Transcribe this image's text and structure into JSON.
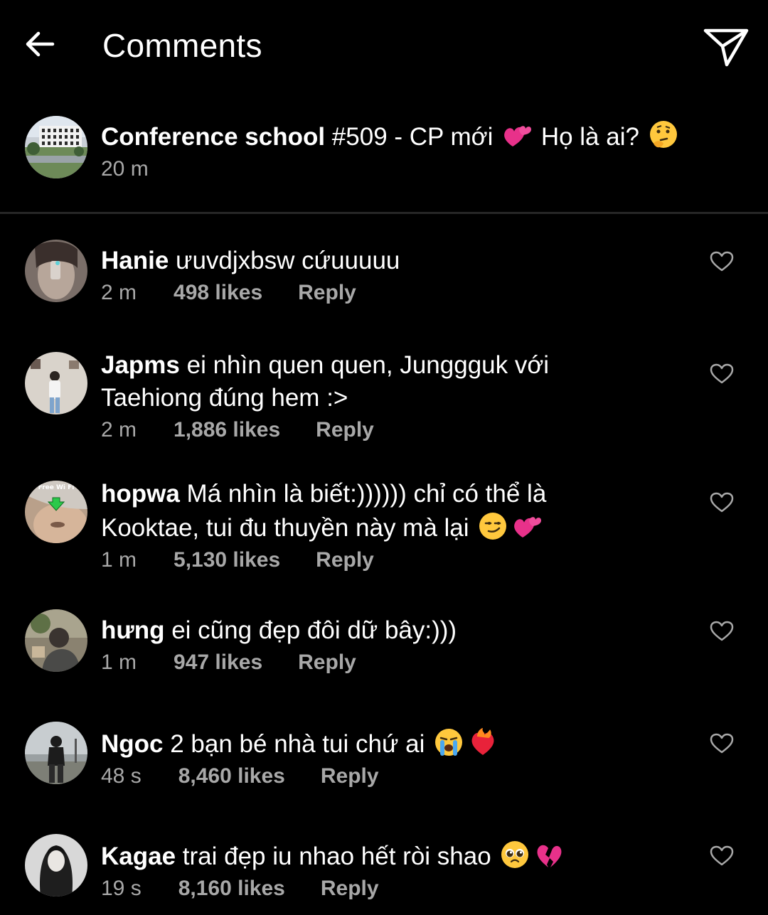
{
  "header": {
    "title": "Comments",
    "back_icon": "arrow-left-icon",
    "share_icon": "paper-plane-icon"
  },
  "caption": {
    "username": "Conference school",
    "text_before_emoji": " #509 - CP mới ",
    "emoji_1": "two-hearts-emoji",
    "text_after_emoji": " Họ là ai? ",
    "emoji_2": "thinking-face-emoji",
    "time": "20 m"
  },
  "comments": [
    {
      "username": "Hanie",
      "text": " ưuvdjxbsw cứuuuuu",
      "time": "2 m",
      "likes": "498 likes",
      "reply": "Reply"
    },
    {
      "username": "Japms",
      "text": " ei nhìn quen quen, Junggguk với\nTaehiong đúng hem :>",
      "time": "2 m",
      "likes": "1,886 likes",
      "reply": "Reply"
    },
    {
      "username": "hopwa",
      "text": " Má nhìn là biết:)))))) chỉ có thể là\nKooktae, tui đu thuyền này mà lại ",
      "emojis": [
        "smirking-face-emoji",
        "two-hearts-emoji"
      ],
      "time": "1 m",
      "likes": "5,130 likes",
      "reply": "Reply",
      "avatar_text": "Free Wi Fi"
    },
    {
      "username": "hưng",
      "text": " ei cũng đẹp đôi dữ bây:)))",
      "time": "1 m",
      "likes": "947 likes",
      "reply": "Reply"
    },
    {
      "username": "Ngoc",
      "text": " 2 bạn bé nhà tui chứ ai ",
      "emojis": [
        "loudly-crying-face-emoji",
        "heart-on-fire-emoji"
      ],
      "time": "48 s",
      "likes": "8,460 likes",
      "reply": "Reply"
    },
    {
      "username": "Kagae",
      "text": " trai đẹp iu nhao hết ròi shao ",
      "emojis": [
        "pleading-face-emoji",
        "broken-heart-emoji"
      ],
      "time": "19 s",
      "likes": "8,160 likes",
      "reply": "Reply"
    }
  ],
  "colors": {
    "background": "#000000",
    "text": "#ffffff",
    "meta_text": "#a8a8a8",
    "divider": "#262626"
  }
}
